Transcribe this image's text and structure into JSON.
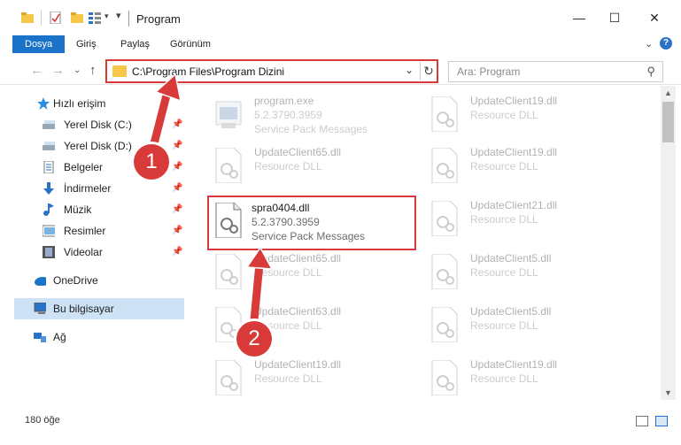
{
  "window": {
    "title": "Program",
    "controls": {
      "minimize": "—",
      "maximize": "☐",
      "close": "✕"
    }
  },
  "ribbon": {
    "tabs": [
      "Dosya",
      "Giriş",
      "Paylaş",
      "Görünüm"
    ],
    "expand_icon": "chevron-down-icon",
    "help_icon": "help-icon"
  },
  "navigation": {
    "back_icon": "arrow-left-icon",
    "forward_icon": "arrow-right-icon",
    "recent_icon": "chevron-down-icon",
    "up_icon": "arrow-up-icon",
    "address_path": "C:\\Program Files\\Program Dizini",
    "search_placeholder": "Ara: Program"
  },
  "sidebar": {
    "items": [
      {
        "label": "Hızlı erişim",
        "icon": "star-icon",
        "pinned": false
      },
      {
        "label": "Yerel Disk (C:)",
        "icon": "drive-icon",
        "pinned": true
      },
      {
        "label": "Yerel Disk (D:)",
        "icon": "drive-icon",
        "pinned": true
      },
      {
        "label": "Belgeler",
        "icon": "document-icon",
        "pinned": true
      },
      {
        "label": "İndirmeler",
        "icon": "download-icon",
        "pinned": true
      },
      {
        "label": "Müzik",
        "icon": "music-icon",
        "pinned": true
      },
      {
        "label": "Resimler",
        "icon": "picture-icon",
        "pinned": true
      },
      {
        "label": "Videolar",
        "icon": "video-icon",
        "pinned": true
      },
      {
        "label": "OneDrive",
        "icon": "cloud-icon",
        "pinned": false
      },
      {
        "label": "Bu bilgisayar",
        "icon": "computer-icon",
        "pinned": false,
        "selected": true
      },
      {
        "label": "Ağ",
        "icon": "network-icon",
        "pinned": false
      }
    ]
  },
  "files": {
    "left_column": [
      {
        "name": "program.exe",
        "version": "5.2.3790.3959",
        "description": "Service Pack Messages",
        "faded": true
      },
      {
        "name": "UpdateClient65.dll",
        "version": "",
        "description": "Resource DLL",
        "faded": true
      },
      {
        "name": "spra0404.dll",
        "version": "5.2.3790.3959",
        "description": "Service Pack Messages",
        "faded": false,
        "highlighted": true
      },
      {
        "name": "UpdateClient65.dll",
        "version": "",
        "description": "Resource DLL",
        "faded": true
      },
      {
        "name": "UpdateClient63.dll",
        "version": "",
        "description": "Resource DLL",
        "faded": true
      },
      {
        "name": "UpdateClient19.dll",
        "version": "",
        "description": "Resource DLL",
        "faded": true
      }
    ],
    "right_column": [
      {
        "name": "UpdateClient19.dll",
        "description": "Resource DLL"
      },
      {
        "name": "UpdateClient19.dll",
        "description": "Resource DLL"
      },
      {
        "name": "UpdateClient21.dll",
        "description": "Resource DLL"
      },
      {
        "name": "UpdateClient5.dll",
        "description": "Resource DLL"
      },
      {
        "name": "UpdateClient5.dll",
        "description": "Resource DLL"
      },
      {
        "name": "UpdateClient19.dll",
        "description": "Resource DLL"
      }
    ]
  },
  "status": {
    "item_count": "180 öğe"
  },
  "callouts": {
    "first": "1",
    "second": "2"
  },
  "colors": {
    "accent": "#1a73c8",
    "highlight": "#d83a3a",
    "selected_bg": "#cde2f5"
  }
}
